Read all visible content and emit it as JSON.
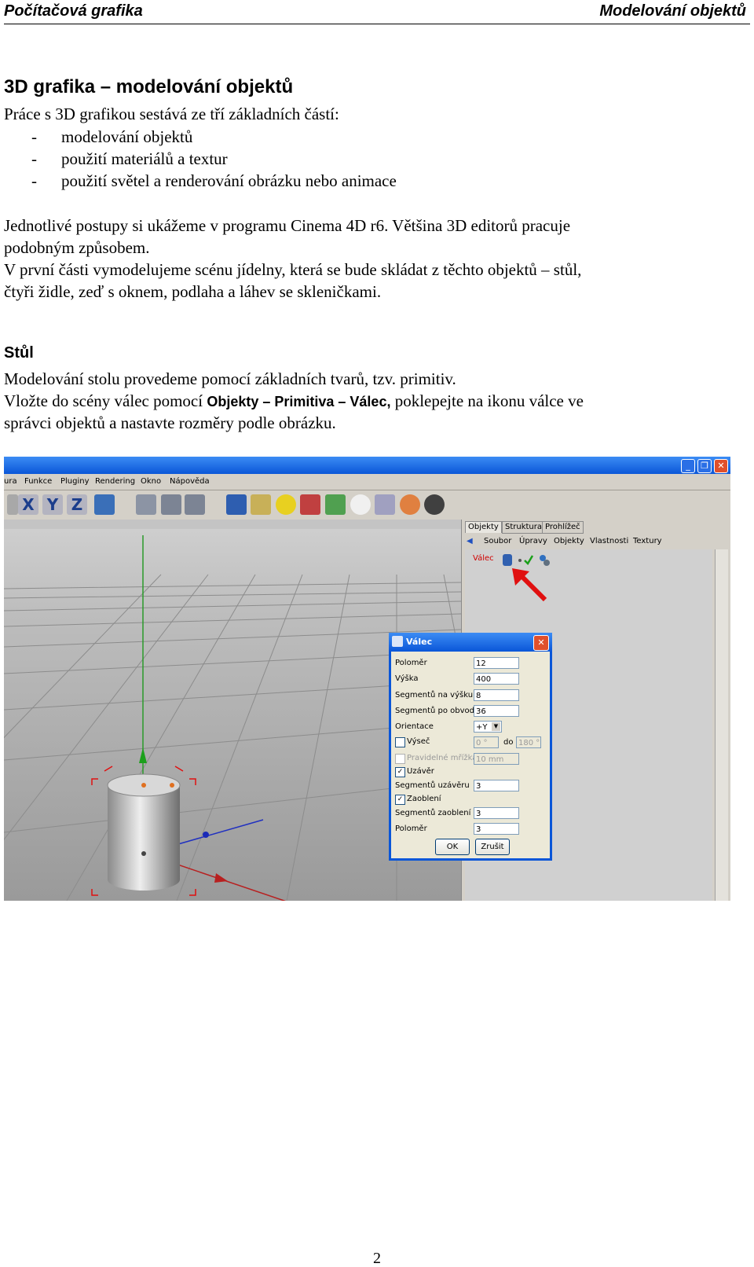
{
  "header": {
    "left": "Počítačová grafika",
    "right": "Modelování objektů"
  },
  "section1": {
    "title": "3D grafika – modelování objektů",
    "intro": "Práce s 3D grafikou sestává ze tří základních částí:",
    "list": [
      "modelování objektů",
      "použití materiálů a textur",
      "použití světel a renderování obrázku nebo animace"
    ],
    "list_dash": "-",
    "para1_line1": "Jednotlivé postupy si ukážeme v programu Cinema 4D r6. Většina 3D editorů pracuje",
    "para1_line2": "podobným způsobem.",
    "para2_line1": "V první části vymodelujeme scénu jídelny, která se bude skládat z těchto objektů – stůl,",
    "para2_line2": "čtyři židle, zeď s oknem, podlaha a láhev se skleničkami."
  },
  "section2": {
    "title": "Stůl",
    "line1": "Modelování stolu provedeme pomocí základních tvarů, tzv. primitiv.",
    "line2_pre": "Vložte do scény válec pomocí ",
    "line2_bold": "Objekty – Primitiva – Válec,",
    "line2_post": " poklepejte na ikonu válce ve",
    "line3": "správci objektů  a nastavte rozměry podle obrázku."
  },
  "screenshot": {
    "menu": [
      "ura",
      "Funkce",
      "Pluginy",
      "Rendering",
      "Okno",
      "Nápověda"
    ],
    "toolbar_axes": [
      "X",
      "Y",
      "Z"
    ],
    "om_tabs": [
      "Objekty",
      "Struktura",
      "Prohlížeč"
    ],
    "om_menu": [
      "Soubor",
      "Úpravy",
      "Objekty",
      "Vlastnosti",
      "Textury"
    ],
    "om_item": "Válec",
    "window_buttons": [
      "_",
      "❐",
      "✕"
    ],
    "dialog": {
      "title": "Válec",
      "close": "✕",
      "fields": [
        {
          "label": "Poloměr",
          "value": "12"
        },
        {
          "label": "Výška",
          "value": "400"
        },
        {
          "label": "Segmentů na výšku",
          "value": "8"
        },
        {
          "label": "Segmentů po obvodu",
          "value": "36"
        }
      ],
      "orientace_label": "Orientace",
      "orientace_value": "+Y",
      "vysec_label": "Výseč",
      "vysec_from": "0 °",
      "vysec_do": "do",
      "vysec_to": "180 °",
      "pravidelne_label": "Pravidelné mřížka",
      "pravidelne_value": "10 mm",
      "uzaver_label": "Uzávěr",
      "segmentu_uzaveru_label": "Segmentů uzávěru",
      "segmentu_uzaveru_value": "3",
      "zaobleni_label": "Zaoblení",
      "segmentu_zaobleni_label": "Segmentů zaoblení",
      "segmentu_zaobleni_value": "3",
      "polomer2_label": "Poloměr",
      "polomer2_value": "3",
      "ok": "OK",
      "cancel": "Zrušit",
      "check_mark": "✓"
    }
  },
  "page_number": "2"
}
